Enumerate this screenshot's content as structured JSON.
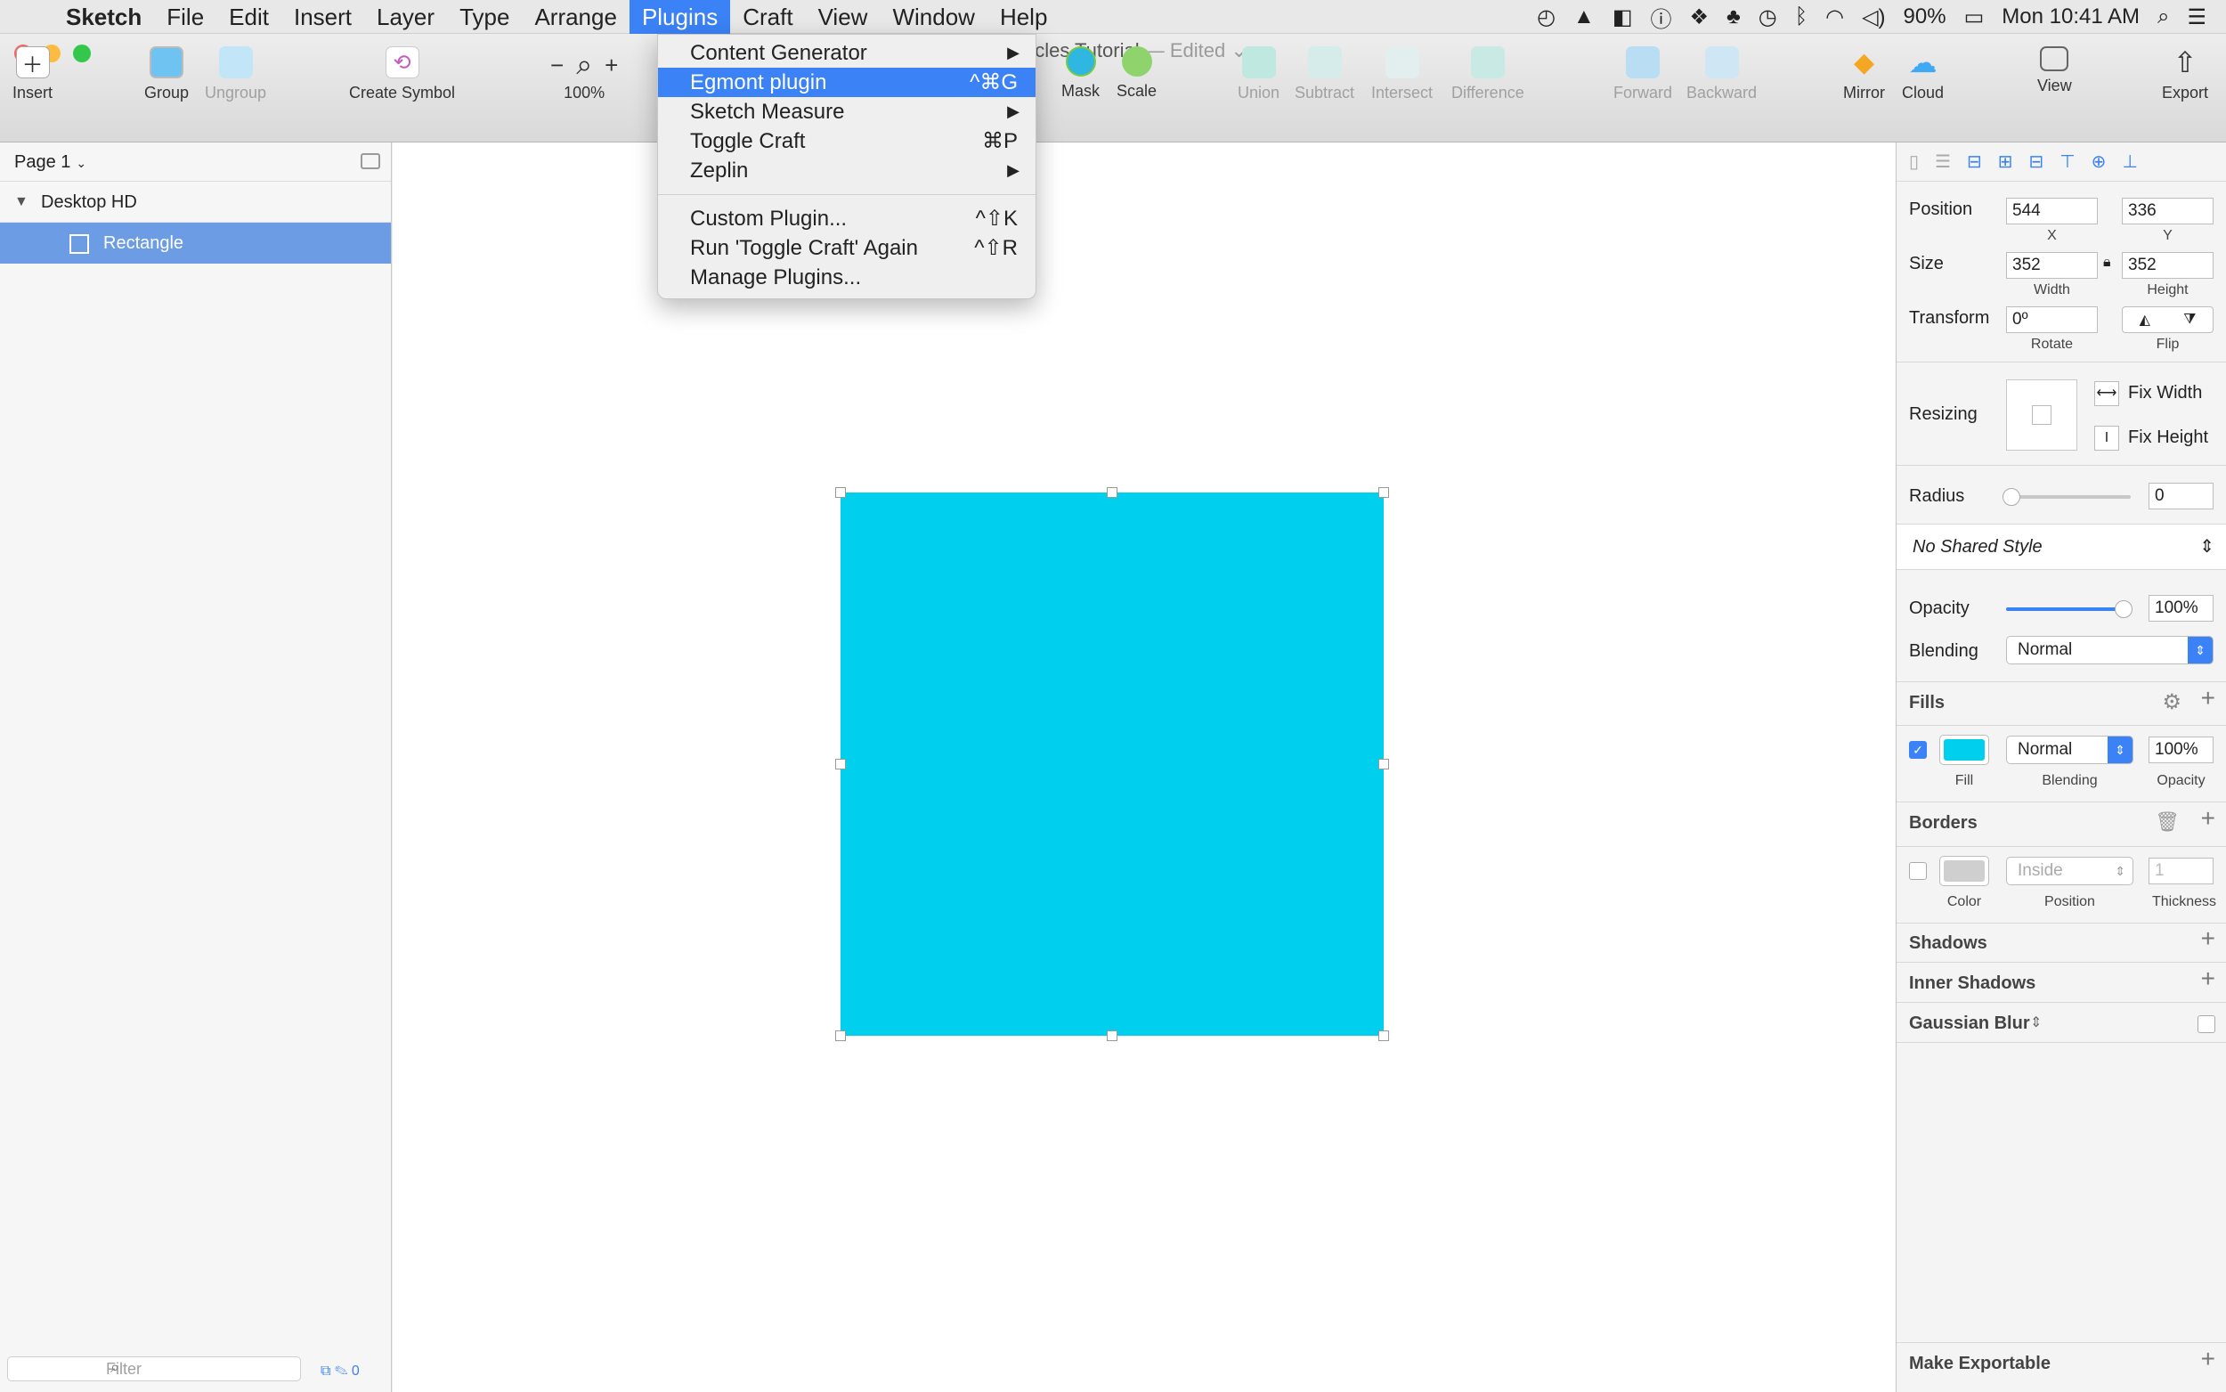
{
  "menubar": {
    "app_name": "Sketch",
    "menus": [
      "File",
      "Edit",
      "Insert",
      "Layer",
      "Type",
      "Arrange",
      "Plugins",
      "Craft",
      "View",
      "Window",
      "Help"
    ],
    "battery": "90%",
    "clock": "Mon 10:41 AM"
  },
  "window": {
    "document_name": "ircles Tutorial",
    "edited_suffix": "— Edited"
  },
  "toolbar": {
    "insert": "Insert",
    "group": "Group",
    "ungroup": "Ungroup",
    "create_symbol": "Create Symbol",
    "zoom_minus": "−",
    "zoom_plus": "+",
    "zoom_level": "100%",
    "mask": "Mask",
    "scale": "Scale",
    "union": "Union",
    "subtract": "Subtract",
    "intersect": "Intersect",
    "difference": "Difference",
    "forward": "Forward",
    "backward": "Backward",
    "mirror": "Mirror",
    "cloud": "Cloud",
    "view": "View",
    "export": "Export"
  },
  "plugins_menu": {
    "items": [
      {
        "label": "Content Generator",
        "shortcut": "",
        "submenu": "▶"
      },
      {
        "label": "Egmont plugin",
        "shortcut": "^⌘G",
        "submenu": ""
      },
      {
        "label": "Sketch Measure",
        "shortcut": "",
        "submenu": "▶"
      },
      {
        "label": "Toggle Craft",
        "shortcut": "⌘P",
        "submenu": ""
      },
      {
        "label": "Zeplin",
        "shortcut": "",
        "submenu": "▶"
      }
    ],
    "items2": [
      {
        "label": "Custom Plugin...",
        "shortcut": "^⇧K"
      },
      {
        "label": "Run 'Toggle Craft' Again",
        "shortcut": "^⇧R"
      },
      {
        "label": "Manage Plugins...",
        "shortcut": ""
      }
    ]
  },
  "layers": {
    "page": "Page 1",
    "artboard": "Desktop HD",
    "selected_layer": "Rectangle",
    "filter_placeholder": "Filter",
    "filter_count": "0"
  },
  "inspector": {
    "position_label": "Position",
    "x": "544",
    "y": "336",
    "x_label": "X",
    "y_label": "Y",
    "size_label": "Size",
    "width": "352",
    "height": "352",
    "width_label": "Width",
    "height_label": "Height",
    "transform_label": "Transform",
    "rotate": "0º",
    "rotate_label": "Rotate",
    "flip_label": "Flip",
    "resizing_label": "Resizing",
    "fix_width": "Fix Width",
    "fix_height": "Fix Height",
    "radius_label": "Radius",
    "radius": "0",
    "shared_style": "No Shared Style",
    "opacity_label": "Opacity",
    "opacity": "100%",
    "blending_label": "Blending",
    "blending": "Normal",
    "fills_label": "Fills",
    "fill_blending": "Normal",
    "fill_opacity": "100%",
    "fill_caption": "Fill",
    "blending_caption": "Blending",
    "opacity_caption": "Opacity",
    "borders_label": "Borders",
    "border_position": "Inside",
    "border_thickness": "1",
    "color_caption": "Color",
    "position_caption": "Position",
    "thickness_caption": "Thickness",
    "shadows_label": "Shadows",
    "inner_shadows_label": "Inner Shadows",
    "gaussian_blur_label": "Gaussian Blur",
    "make_exportable": "Make Exportable"
  },
  "colors": {
    "accent": "#3b82f6",
    "rectangle_fill": "#00cfee"
  }
}
